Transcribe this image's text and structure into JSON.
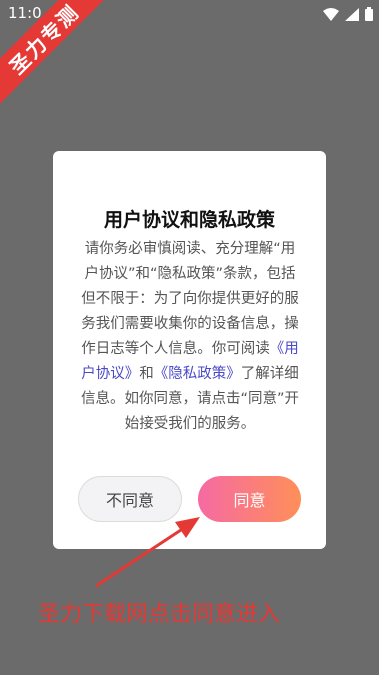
{
  "status_bar": {
    "time": "11:0"
  },
  "watermark": {
    "text": "圣力专测"
  },
  "dialog": {
    "title": "用户协议和隐私政策",
    "body_prefix": "请你务必审慎阅读、充分理解“用户协议”和“隐私政策”条款，包括但不限于：为了向你提供更好的服务我们需要收集你的设备信息，操作日志等个人信息。你可阅读",
    "link_user_agreement": "《用户协议》",
    "body_and": "和",
    "link_privacy_policy": "《隐私政策》",
    "body_suffix": "了解详细信息。如你同意，请点击“同意”开始接受我们的服务。",
    "decline_label": "不同意",
    "agree_label": "同意"
  },
  "annotation": {
    "text": "圣力下载网点击同意进入"
  },
  "colors": {
    "accent_red": "#e53935",
    "link": "#4a4ac8",
    "agree_gradient_start": "#f56aa3",
    "agree_gradient_end": "#ff8f59"
  },
  "icons": [
    "wifi-icon",
    "signal-icon",
    "battery-icon"
  ]
}
